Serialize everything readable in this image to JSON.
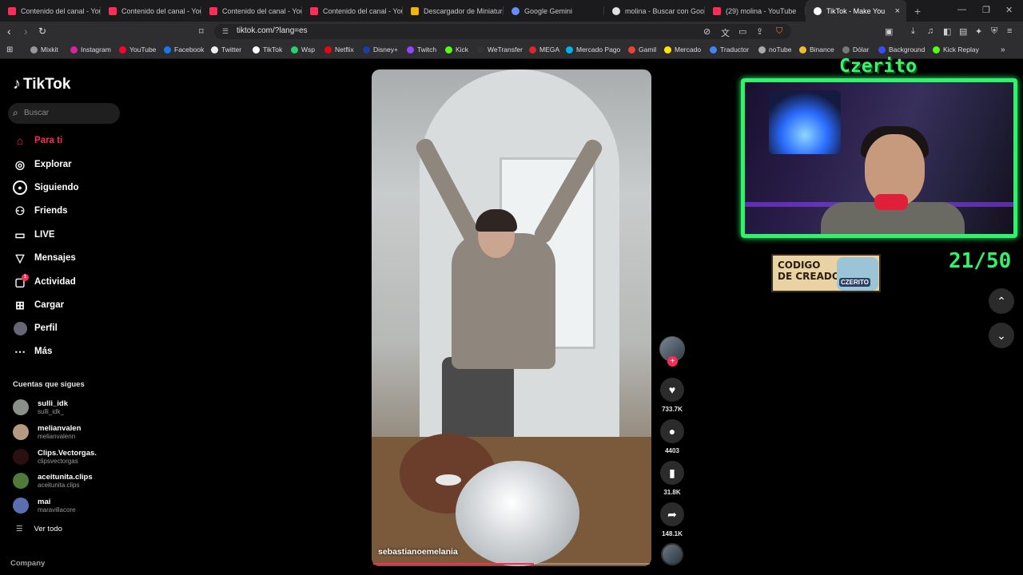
{
  "browser": {
    "tabs": [
      {
        "title": "Contenido del canal - You",
        "icon": "youtube-icon",
        "color": "#ff2d55"
      },
      {
        "title": "Contenido del canal - You",
        "icon": "youtube-icon",
        "color": "#ff2d55"
      },
      {
        "title": "Contenido del canal - You",
        "icon": "youtube-icon",
        "color": "#ff2d55"
      },
      {
        "title": "Contenido del canal - You",
        "icon": "youtube-icon",
        "color": "#ff2d55"
      },
      {
        "title": "Descargador de Miniatura",
        "icon": "house-icon",
        "color": "#f5b400"
      },
      {
        "title": "Google Gemini",
        "icon": "gemini-icon",
        "color": "#6a8cff"
      },
      {
        "title": "molina - Buscar con Goog",
        "icon": "google-icon",
        "color": "#e0e0e0"
      },
      {
        "title": "(29) molina - YouTube",
        "icon": "youtube-icon",
        "color": "#ff2d55"
      },
      {
        "title": "TikTok - Make You",
        "icon": "tiktok-icon",
        "color": "#ffffff"
      }
    ],
    "url": "tiktok.com/?lang=es",
    "bookmarks": [
      "Mixkit",
      "Instagram",
      "YouTube",
      "Facebook",
      "Twitter",
      "TikTok",
      "Wsp",
      "Netflix",
      "Disney+",
      "Twitch",
      "Kick",
      "WeTransfer",
      "MEGA",
      "Mercado Pago",
      "Gamil",
      "Mercado",
      "Traductor",
      "noTube",
      "Binance",
      "Dólar",
      "Background",
      "Kick Replay"
    ]
  },
  "tiktok": {
    "logo": "TikTok",
    "search_placeholder": "Buscar",
    "nav": [
      {
        "label": "Para ti",
        "icon": "home-icon",
        "active": true
      },
      {
        "label": "Explorar",
        "icon": "compass-icon"
      },
      {
        "label": "Siguiendo",
        "icon": "following-icon"
      },
      {
        "label": "Friends",
        "icon": "friends-icon"
      },
      {
        "label": "LIVE",
        "icon": "live-icon"
      },
      {
        "label": "Mensajes",
        "icon": "messages-icon"
      },
      {
        "label": "Actividad",
        "icon": "activity-icon",
        "badge": "1"
      },
      {
        "label": "Cargar",
        "icon": "upload-icon"
      },
      {
        "label": "Perfil",
        "icon": "profile-icon"
      },
      {
        "label": "Más",
        "icon": "more-icon"
      }
    ],
    "following_title": "Cuentas que sigues",
    "following": [
      {
        "name": "sulli_idk",
        "handle": "sulli_idk_"
      },
      {
        "name": "melianvalen",
        "handle": "melianvalenn"
      },
      {
        "name": "Clips.Vectorgas.",
        "handle": "clipsvectorgas"
      },
      {
        "name": "aceitunita.clips",
        "handle": "aceitunita.clips"
      },
      {
        "name": "mai",
        "handle": "maravillacore"
      }
    ],
    "see_all": "Ver todo",
    "company": "Company",
    "video": {
      "author": "sebastianoemelania",
      "progress": 0.58,
      "likes": "733.7K",
      "comments": "4403",
      "saves": "31.8K",
      "shares": "148.1K"
    },
    "accent": "#fe2c55"
  },
  "overlay": {
    "cam_name": "Czerito",
    "creator_code_line1": "CODIGO",
    "creator_code_line2": "DE CREADOR",
    "creator_code_logo": "CZERITO",
    "counter": "21/50",
    "accent": "#2ff36a"
  }
}
